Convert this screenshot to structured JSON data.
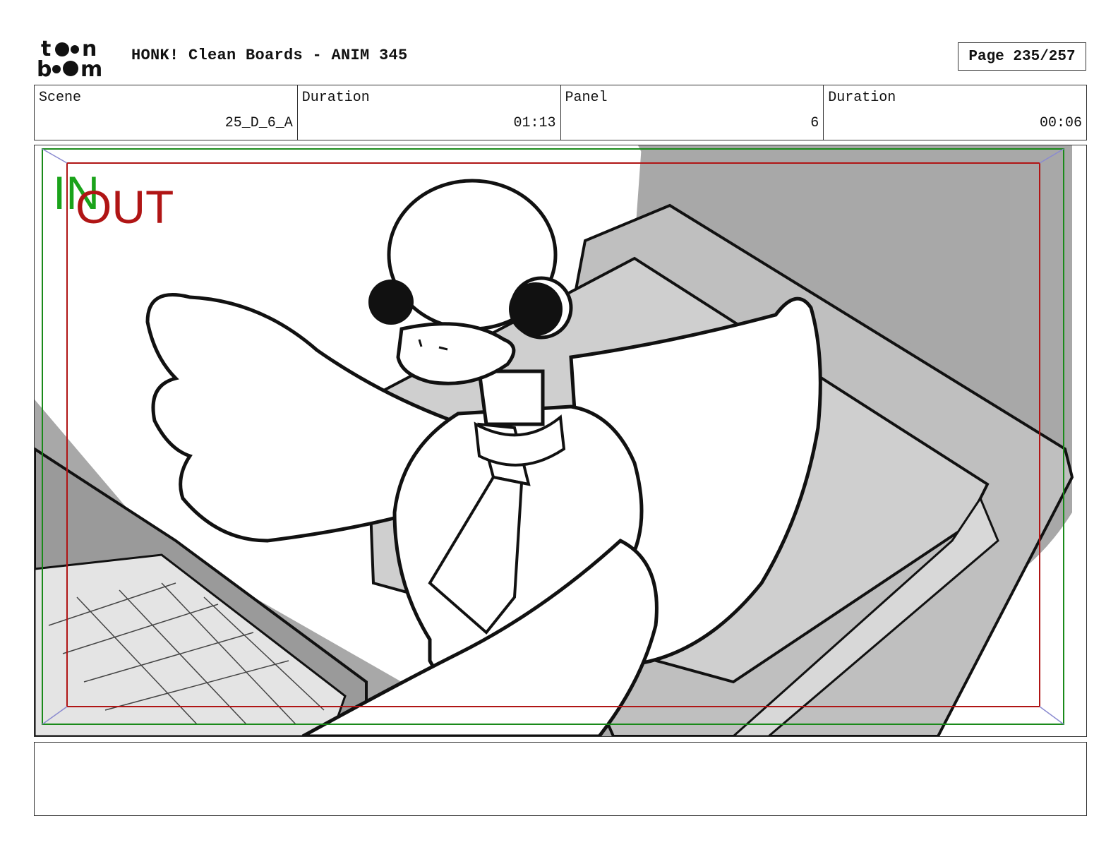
{
  "header": {
    "logo_text": "toon boom",
    "title": "HONK! Clean Boards - ANIM 345",
    "page_label": "Page 235/257"
  },
  "info": [
    {
      "label": "Scene",
      "value": "25_D_6_A"
    },
    {
      "label": "Duration",
      "value": "01:13"
    },
    {
      "label": "Panel",
      "value": "6"
    },
    {
      "label": "Duration",
      "value": "00:06"
    }
  ],
  "panel": {
    "in_label": "IN",
    "out_label": "OUT",
    "colors": {
      "in_frame": "#1a8a1a",
      "out_frame": "#b01515",
      "dark_gray": "#a8a8a8",
      "mid_gray": "#c6c6c6",
      "light_gray": "#e2e2e2"
    }
  },
  "notes": {
    "text": ""
  }
}
